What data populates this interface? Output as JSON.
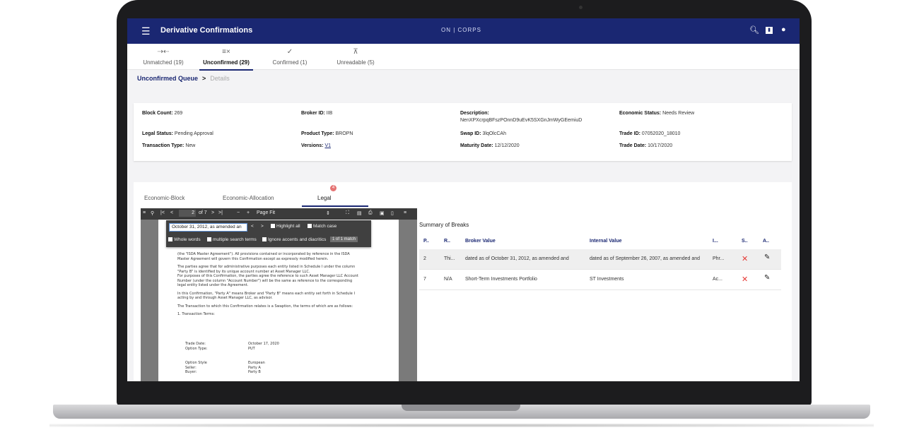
{
  "app": {
    "title": "Derivative Confirmations",
    "brand": "ON | CORPS",
    "menu_icon": "menu-icon",
    "header_icons": [
      "search-icon",
      "chart-icon",
      "user-icon"
    ]
  },
  "tabs": [
    {
      "icon": "unmatched-icon",
      "label": "Unmatched (19)"
    },
    {
      "icon": "unconfirmed-icon",
      "label": "Unconfirmed (29)"
    },
    {
      "icon": "confirmed-icon",
      "label": "Confirmed (1)"
    },
    {
      "icon": "unreadable-icon",
      "label": "Unreadable (5)"
    }
  ],
  "breadcrumb": {
    "current": "Unconfirmed Queue",
    "separator": ">",
    "next": "Details"
  },
  "details": {
    "block_count": {
      "label": "Block Count:",
      "value": "269"
    },
    "broker_id": {
      "label": "Broker ID:",
      "value": "IIB"
    },
    "description": {
      "label": "Description:",
      "value": "NenXPXcrpqBFszPOnnD9uEvK5SXGnJmWyGEemiuD"
    },
    "economic_status": {
      "label": "Economic Status:",
      "value": "Needs Review"
    },
    "legal_status": {
      "label": "Legal Status:",
      "value": "Pending Approval"
    },
    "product_type": {
      "label": "Product Type:",
      "value": "BROPN"
    },
    "swap_id": {
      "label": "Swap ID:",
      "value": "3lqOlcCAh"
    },
    "trade_id": {
      "label": "Trade ID:",
      "value": "07052020_18010"
    },
    "transaction_type": {
      "label": "Transaction Type:",
      "value": "New"
    },
    "versions": {
      "label": "Versions:",
      "value": "V1"
    },
    "maturity_date": {
      "label": "Maturity Date:",
      "value": "12/12/2020"
    },
    "trade_date": {
      "label": "Trade Date:",
      "value": "10/17/2020"
    }
  },
  "panel_tabs": [
    {
      "label": "Economic-Block"
    },
    {
      "label": "Economic-Allocation"
    },
    {
      "label": "Legal",
      "badge": "4"
    }
  ],
  "pdf_toolbar": {
    "page_current": "2",
    "page_total": "of 7",
    "zoom": "Page Fit",
    "zoom_out": "−",
    "zoom_in": "+"
  },
  "find_bar": {
    "query": "October 31, 2012, as amended an",
    "highlight_all": "Highlight all",
    "match_case": "Match case",
    "whole_words": "Whole words",
    "multiple_terms": "multiple search terms",
    "ignore_accents": "Ignore accents and diacritics",
    "match_count": "1 of 1 match"
  },
  "document_lines": [
    "(the \"ISDA Master Agreement\"). All provisions contained or incorporated by reference in the ISDA",
    "Master Agreement will govern this Confirmation except as expressly modified herein.",
    "The parties agree that for administrative purposes each entity listed in Schedule I under the column",
    "\"Party B\" is identified by its unique account number at Asset Manager LLC.",
    "For purposes of this Confirmation, the parties agree the reference to such Asset Manager LLC Account",
    "Number (under the column \"Account Number\") will be the same as reference to the corresponding",
    "legal entity listed under the Agreement.",
    "In this Confirmation, \"Party A\" means Broker and \"Party B\" means each entity set forth in Schedule I",
    "acting by and through Asset Manager LLC, as advisor.",
    "The Transaction to which this Confirmation relates is a Swaption, the terms of which are as follows:",
    "1. Transaction Terms:"
  ],
  "document_terms": [
    {
      "k": "Trade Date:",
      "v": "October 17, 2020"
    },
    {
      "k": "Option Type:",
      "v": "PUT"
    },
    {
      "k": "Option Style",
      "v": "European"
    },
    {
      "k": "Seller:",
      "v": "Party A"
    },
    {
      "k": "Buyer:",
      "v": "Party B"
    }
  ],
  "summary": {
    "title": "Summary of Breaks",
    "headers": [
      "P..",
      "R..",
      "Broker Value",
      "Internal Value",
      "I...",
      "S..",
      "A.."
    ],
    "rows": [
      {
        "p": "2",
        "r": "Thi...",
        "broker": "dated as of October 31, 2012, as amended and",
        "internal": "dated as of September 26, 2007, as amended and",
        "i": "Phr...",
        "s_icon": "close-icon",
        "a_icon": "edit-icon"
      },
      {
        "p": "7",
        "r": "N/A",
        "broker": "Short-Term Investments Portfolio",
        "internal": "ST Investments",
        "i": "Ac...",
        "s_icon": "close-icon",
        "a_icon": "edit-icon"
      }
    ]
  },
  "colors": {
    "header": "#1a2772",
    "accent": "#1a2772",
    "reject": "#e53935",
    "badge": "#e57373"
  }
}
